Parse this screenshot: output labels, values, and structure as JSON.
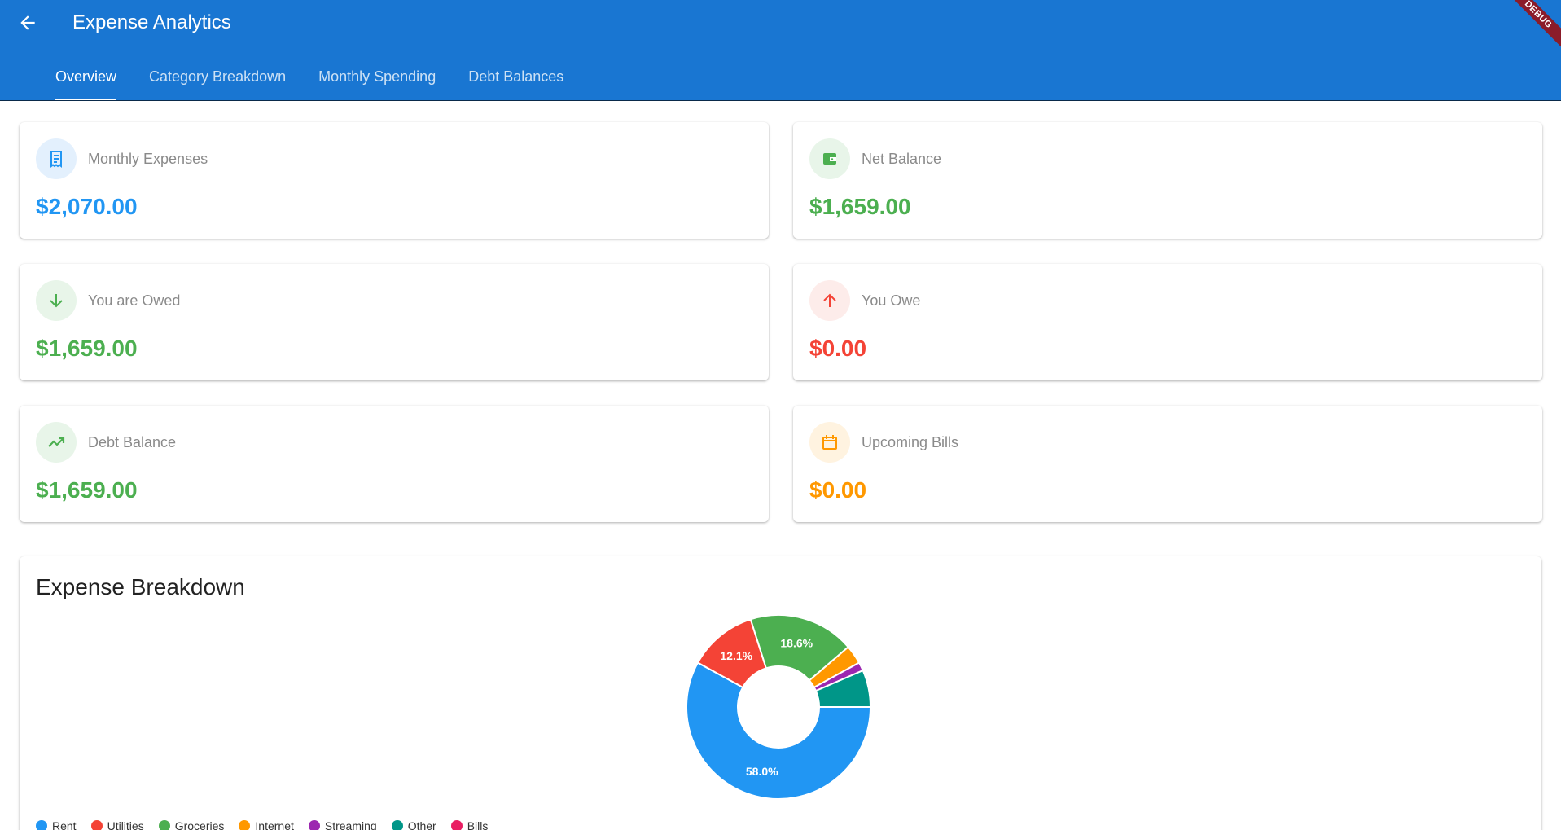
{
  "app": {
    "title": "Expense Analytics",
    "debug_label": "DEBUG"
  },
  "tabs": [
    {
      "label": "Overview",
      "active": true
    },
    {
      "label": "Category Breakdown",
      "active": false
    },
    {
      "label": "Monthly Spending",
      "active": false
    },
    {
      "label": "Debt Balances",
      "active": false
    }
  ],
  "stats": [
    {
      "label": "Monthly Expenses",
      "value": "$2,070.00",
      "icon": "receipt-icon",
      "color": "#2196f3",
      "bg": "#e3f0fd"
    },
    {
      "label": "Net Balance",
      "value": "$1,659.00",
      "icon": "wallet-icon",
      "color": "#4caf50",
      "bg": "#e8f5e9"
    },
    {
      "label": "You are Owed",
      "value": "$1,659.00",
      "icon": "arrow-down-icon",
      "color": "#4caf50",
      "bg": "#e8f5e9"
    },
    {
      "label": "You Owe",
      "value": "$0.00",
      "icon": "arrow-up-icon",
      "color": "#f44336",
      "bg": "#fdecea"
    },
    {
      "label": "Debt Balance",
      "value": "$1,659.00",
      "icon": "trending-up-icon",
      "color": "#4caf50",
      "bg": "#e8f5e9"
    },
    {
      "label": "Upcoming Bills",
      "value": "$0.00",
      "icon": "calendar-icon",
      "color": "#ff9800",
      "bg": "#fff3e0"
    }
  ],
  "chart": {
    "title": "Expense Breakdown"
  },
  "chart_data": {
    "type": "pie",
    "categories": [
      "Rent",
      "Utilities",
      "Groceries",
      "Internet",
      "Streaming",
      "Other",
      "Bills"
    ],
    "values": [
      58.0,
      12.1,
      18.6,
      3.3,
      1.5,
      6.5,
      0.0
    ],
    "colors": [
      "#2196f3",
      "#f44336",
      "#4caf50",
      "#ff9800",
      "#9c27b0",
      "#009688",
      "#e91e63"
    ],
    "data_labels": [
      "58.0%",
      "12.1%",
      "18.6%",
      "",
      "",
      "",
      ""
    ],
    "donut": true,
    "legend": "bottom"
  }
}
